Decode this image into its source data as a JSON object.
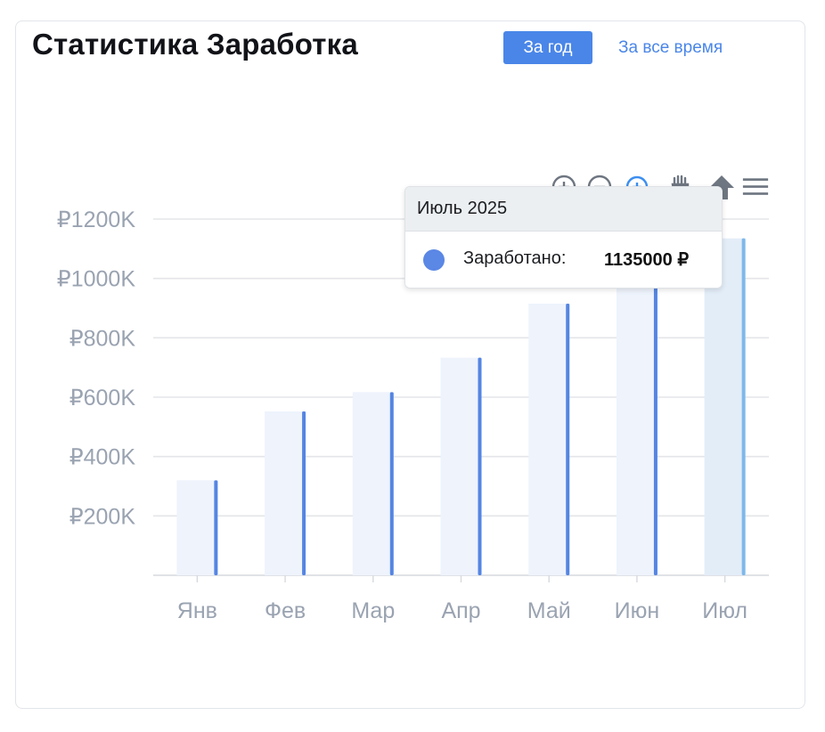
{
  "header": {
    "title": "Статистика Заработка"
  },
  "filters": {
    "year_label": "За год",
    "all_time_label": "За все время"
  },
  "tooltip": {
    "title": "Июль 2025",
    "label": "Заработано:",
    "value": "1135000 ₽"
  },
  "toolbar": {
    "icons": [
      "zoom-in-icon",
      "zoom-out-icon",
      "zoom-reset-icon",
      "pan-hand-icon",
      "home-icon",
      "menu-icon"
    ]
  },
  "colors": {
    "accent": "#4a86e8",
    "bar_bg": "#eef3fc",
    "bar_bg_active": "#e3edf8",
    "bar_line": "#5585e2",
    "bar_line_active": "#7fb8ea",
    "axis_text": "#9aa3b1",
    "grid": "#e3e5e8"
  },
  "chart_data": {
    "type": "bar",
    "categories": [
      "Янв",
      "Фев",
      "Мар",
      "Апр",
      "Май",
      "Июн",
      "Июл"
    ],
    "values": [
      320000,
      552000,
      617000,
      733000,
      915000,
      1045000,
      1135000
    ],
    "ylim": [
      0,
      1200000
    ],
    "yticks": [
      200000,
      400000,
      600000,
      800000,
      1000000,
      1200000
    ],
    "ytick_labels": [
      "₽200K",
      "₽400K",
      "₽600K",
      "₽800K",
      "₽1000K",
      "₽1200K"
    ],
    "highlighted_index": 6,
    "grid": true
  }
}
